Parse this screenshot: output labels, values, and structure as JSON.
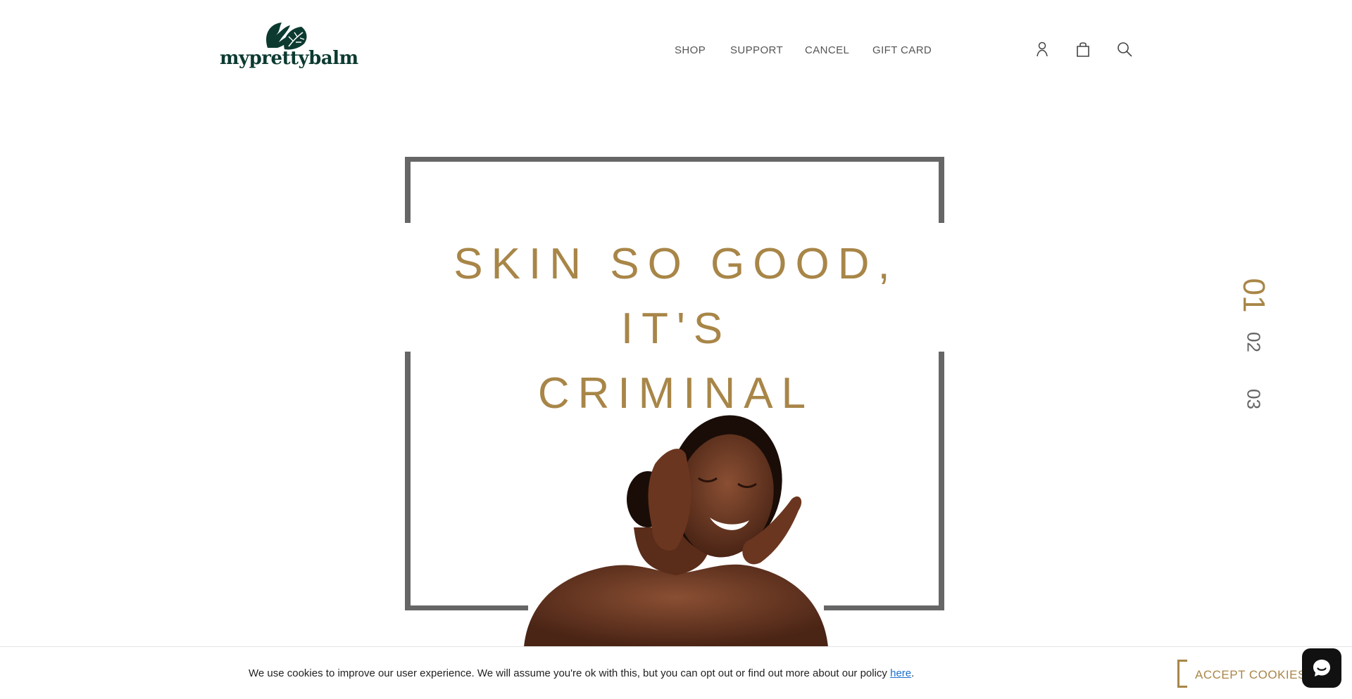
{
  "brand": {
    "name": "myprettybalm",
    "logo_icon": "monstera-leaf-logo",
    "color": "#0c3a30"
  },
  "nav": {
    "items": [
      {
        "label": "SHOP"
      },
      {
        "label": "SUPPORT"
      },
      {
        "label": "CANCEL"
      },
      {
        "label": "GIFT CARD"
      }
    ]
  },
  "header_icons": [
    "account-icon",
    "bag-icon",
    "search-icon"
  ],
  "hero": {
    "headline_line1": "SKIN SO GOOD, IT'S",
    "headline_line2": "CRIMINAL",
    "accent_color": "#a88648",
    "frame_color": "#666666"
  },
  "slides": {
    "items": [
      "01",
      "02",
      "03"
    ],
    "active": "01"
  },
  "cookie": {
    "message": "We use cookies to improve our user experience. We will assume you're ok with this, but you can opt out or find out more about our policy ",
    "link_label": "here",
    "period": ".",
    "accept_label": "ACCEPT COOKIES"
  },
  "chat": {
    "icon": "chat-bubble-icon"
  }
}
